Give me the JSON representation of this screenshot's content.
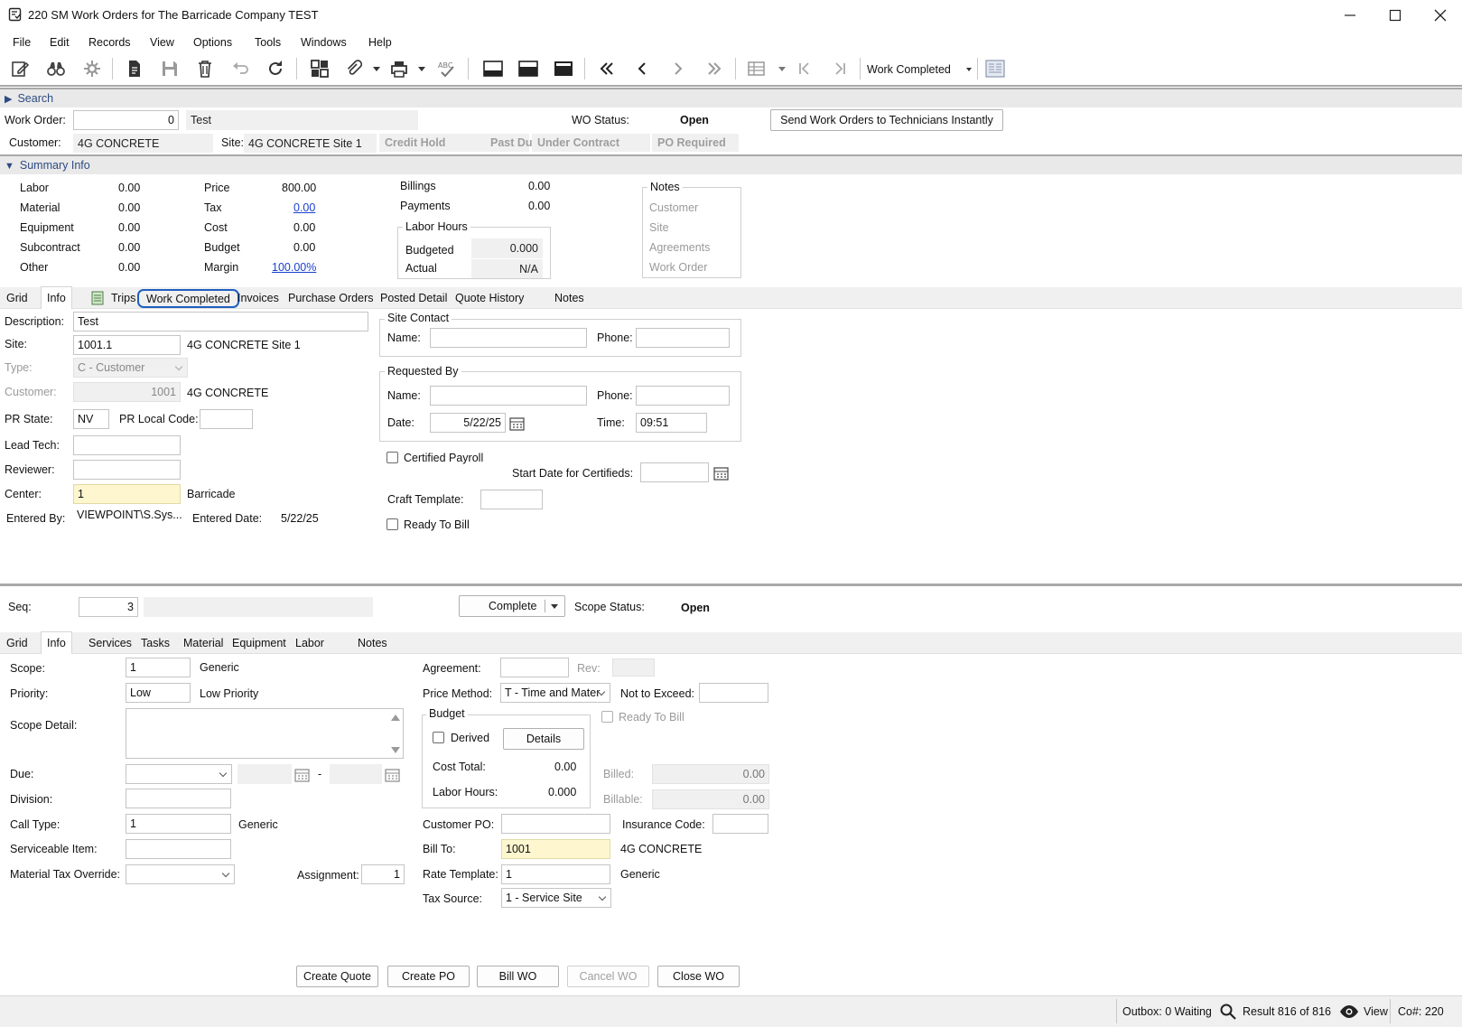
{
  "window": {
    "title": "220 SM Work Orders for The Barricade Company TEST"
  },
  "menu": [
    "File",
    "Edit",
    "Records",
    "View",
    "Options",
    "Tools",
    "Windows",
    "Help"
  ],
  "toolbar": {
    "view_dropdown": "Work Completed"
  },
  "search_bar": {
    "label": "Search"
  },
  "header": {
    "work_order_label": "Work Order:",
    "work_order_value": "0",
    "work_order_desc": "Test",
    "wo_status_label": "WO Status:",
    "wo_status_value": "Open",
    "send_button": "Send Work Orders to Technicians Instantly",
    "customer_label": "Customer:",
    "customer_value": "4G CONCRETE",
    "site_label": "Site:",
    "site_value": "4G CONCRETE Site 1",
    "flags": [
      "Credit Hold",
      "Past Due",
      "Under Contract",
      "PO Required"
    ]
  },
  "summary": {
    "bar_label": "Summary Info",
    "col1": [
      {
        "label": "Labor",
        "value": "0.00"
      },
      {
        "label": "Material",
        "value": "0.00"
      },
      {
        "label": "Equipment",
        "value": "0.00"
      },
      {
        "label": "Subcontract",
        "value": "0.00"
      },
      {
        "label": "Other",
        "value": "0.00"
      }
    ],
    "col2": [
      {
        "label": "Price",
        "value": "800.00"
      },
      {
        "label": "Tax",
        "value": "0.00"
      },
      {
        "label": "Cost",
        "value": "0.00"
      },
      {
        "label": "Budget",
        "value": "0.00"
      },
      {
        "label": "Margin",
        "value": "100.00%"
      }
    ],
    "billings_label": "Billings",
    "billings_value": "0.00",
    "payments_label": "Payments",
    "payments_value": "0.00",
    "labor_hours_title": "Labor Hours",
    "budgeted_label": "Budgeted",
    "budgeted_value": "0.000",
    "actual_label": "Actual",
    "actual_value": "N/A",
    "notes_title": "Notes",
    "notes_items": [
      "Customer",
      "Site",
      "Agreements",
      "Work Order"
    ]
  },
  "tabs_top": [
    "Grid",
    "Info",
    "Trips",
    "Work Completed",
    "Invoices",
    "Purchase Orders",
    "Posted Detail",
    "Quote History",
    "Notes"
  ],
  "info": {
    "description_label": "Description:",
    "description_value": "Test",
    "site_label": "Site:",
    "site_value": "1001.1",
    "site_desc": "4G CONCRETE Site 1",
    "type_label": "Type:",
    "type_value": "C - Customer",
    "customer_label": "Customer:",
    "customer_value": "1001",
    "customer_desc": "4G CONCRETE",
    "pr_state_label": "PR State:",
    "pr_state_value": "NV",
    "pr_local_label": "PR Local Code:",
    "pr_local_value": "",
    "lead_tech_label": "Lead Tech:",
    "reviewer_label": "Reviewer:",
    "center_label": "Center:",
    "center_value": "1",
    "center_desc": "Barricade",
    "entered_by_label": "Entered By:",
    "entered_by_value": "VIEWPOINT\\S.Sys...",
    "entered_date_label": "Entered Date:",
    "entered_date_value": "5/22/25",
    "site_contact_title": "Site Contact",
    "name_label": "Name:",
    "phone_label": "Phone:",
    "requested_by_title": "Requested By",
    "date_label": "Date:",
    "date_value": "5/22/25",
    "time_label": "Time:",
    "time_value": "09:51",
    "certified_payroll_label": "Certified Payroll",
    "start_date_certified_label": "Start Date for Certifieds:",
    "craft_template_label": "Craft Template:",
    "ready_to_bill_label": "Ready To Bill"
  },
  "scope_header": {
    "seq_label": "Seq:",
    "seq_value": "3",
    "complete_button": "Complete",
    "scope_status_label": "Scope Status:",
    "scope_status_value": "Open"
  },
  "tabs_bottom": [
    "Grid",
    "Info",
    "Services",
    "Tasks",
    "Material",
    "Equipment",
    "Labor",
    "Notes"
  ],
  "scope": {
    "scope_label": "Scope:",
    "scope_value": "1",
    "scope_desc": "Generic",
    "priority_label": "Priority:",
    "priority_value": "Low",
    "priority_desc": "Low Priority",
    "scope_detail_label": "Scope Detail:",
    "due_label": "Due:",
    "due_dash": "-",
    "division_label": "Division:",
    "call_type_label": "Call Type:",
    "call_type_value": "1",
    "call_type_desc": "Generic",
    "serviceable_label": "Serviceable Item:",
    "mat_tax_label": "Material Tax Override:",
    "assignment_label": "Assignment:",
    "assignment_value": "1",
    "agreement_label": "Agreement:",
    "rev_label": "Rev:",
    "price_method_label": "Price Method:",
    "price_method_value": "T - Time and Mater",
    "nte_label": "Not to Exceed:",
    "ready_to_bill_label": "Ready To Bill",
    "budget_title": "Budget",
    "derived_label": "Derived",
    "details_button": "Details",
    "cost_total_label": "Cost Total:",
    "cost_total_value": "0.00",
    "labor_hours_label": "Labor Hours:",
    "labor_hours_value": "0.000",
    "billed_label": "Billed:",
    "billed_value": "0.00",
    "billable_label": "Billable:",
    "billable_value": "0.00",
    "customer_po_label": "Customer PO:",
    "insurance_label": "Insurance Code:",
    "bill_to_label": "Bill To:",
    "bill_to_value": "1001",
    "bill_to_desc": "4G CONCRETE",
    "rate_template_label": "Rate Template:",
    "rate_template_value": "1",
    "rate_template_desc": "Generic",
    "tax_source_label": "Tax Source:",
    "tax_source_value": "1 - Service Site"
  },
  "actions": [
    "Create Quote",
    "Create PO",
    "Bill WO",
    "Cancel WO",
    "Close WO"
  ],
  "status": {
    "outbox": "Outbox: 0 Waiting",
    "result": "Result 816 of 816",
    "view": "View",
    "company": "Co#: 220"
  },
  "colors": {
    "highlight_ring": "#1f5fbf",
    "required_field": "#fdf6cf",
    "link": "#1a3fcf"
  }
}
